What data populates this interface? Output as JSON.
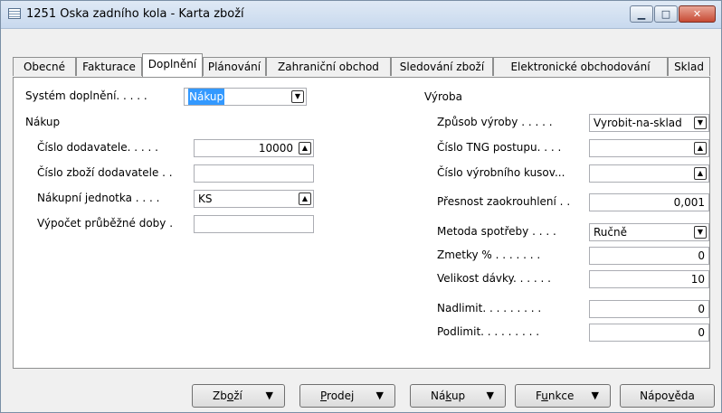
{
  "window": {
    "title": "1251 Oska zadního kola - Karta zboží",
    "minimize": "▁",
    "maximize": "□",
    "close": "✕"
  },
  "tabs": [
    {
      "label": "Obecné"
    },
    {
      "label": "Fakturace"
    },
    {
      "label": "Doplnění"
    },
    {
      "label": "Plánování"
    },
    {
      "label": "Zahraniční obchod"
    },
    {
      "label": "Sledování zboží"
    },
    {
      "label": "Elektronické obchodování"
    },
    {
      "label": "Sklad"
    }
  ],
  "active_tab": "Doplnění",
  "left": {
    "system_label": "Systém doplnění. . . . .",
    "system_value": "Nákup",
    "section_title": "Nákup",
    "rows": [
      {
        "label": "Číslo dodavatele. . . . .",
        "value": "10000"
      },
      {
        "label": "Číslo zboží dodavatele . .",
        "value": ""
      },
      {
        "label": "Nákupní jednotka . . . .",
        "value": "KS"
      },
      {
        "label": "Výpočet průběžné doby .",
        "value": ""
      }
    ]
  },
  "right": {
    "section_title": "Výroba",
    "rows": [
      {
        "label": "Způsob výroby . . . . .",
        "value": "Vyrobit-na-sklad"
      },
      {
        "label": "Číslo TNG postupu. . . .",
        "value": ""
      },
      {
        "label": "Číslo výrobního kusov...",
        "value": ""
      },
      {
        "label": "Přesnost zaokrouhlení . .",
        "value": "0,001"
      },
      {
        "label": "Metoda spotřeby . . . .",
        "value": "Ručně"
      },
      {
        "label": "Zmetky % . . . . . . .",
        "value": "0"
      },
      {
        "label": "Velikost dávky. . . . . .",
        "value": "10"
      },
      {
        "label": "Nadlimit. . . . . . . . .",
        "value": "0"
      },
      {
        "label": "Podlimit. . . . . . . . .",
        "value": "0"
      }
    ]
  },
  "icons": {
    "dropdown": "▼",
    "lookup": "▲",
    "menu_arrow": "▼"
  },
  "buttons": [
    {
      "pre": "Zb",
      "mnemonic": "o",
      "post": "ží"
    },
    {
      "pre": "",
      "mnemonic": "P",
      "post": "rodej"
    },
    {
      "pre": "Ná",
      "mnemonic": "k",
      "post": "up"
    },
    {
      "pre": "F",
      "mnemonic": "u",
      "post": "nkce"
    },
    {
      "pre": "Nápo",
      "mnemonic": "v",
      "post": "ěda"
    }
  ]
}
